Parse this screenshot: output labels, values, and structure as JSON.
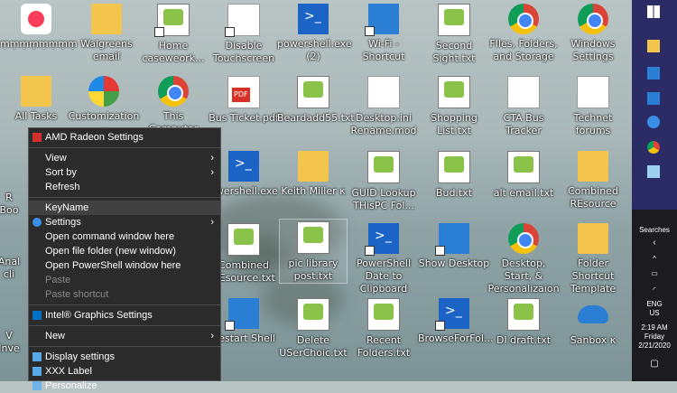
{
  "desktop_icons": [
    {
      "label": "ṃṃṃṃṃṃṃṃ",
      "kind": "itunes-icon"
    },
    {
      "label": "Walgreens email",
      "kind": "folder-icon"
    },
    {
      "label": "Home caseweork...",
      "kind": "text-file-icon"
    },
    {
      "label": "Disable Touchscreen",
      "kind": "document-icon"
    },
    {
      "label": "powershell.exe (2)",
      "kind": "powershell-icon"
    },
    {
      "label": "Wi-Fi - Shortcut",
      "kind": "wifi-icon"
    },
    {
      "label": "Second Sight.txt",
      "kind": "text-file-icon"
    },
    {
      "label": "FIles, Folders, and Storage",
      "kind": "chrome-icon"
    },
    {
      "label": "Windows Settings",
      "kind": "chrome-icon"
    },
    {
      "label": "All Tasks",
      "kind": "folder-icon"
    },
    {
      "label": "Customization -",
      "kind": "shell-icon"
    },
    {
      "label": "This Computer",
      "kind": "chrome-icon"
    },
    {
      "label": "Bus Ticket.pdf",
      "kind": "pdf-icon"
    },
    {
      "label": "Beardadd55.txt",
      "kind": "text-file-icon"
    },
    {
      "label": "Desktop.ini Rename.mod",
      "kind": "document-icon"
    },
    {
      "label": "Shopping List.txt",
      "kind": "text-file-icon"
    },
    {
      "label": "CTA Bus Tracker",
      "kind": "document-icon"
    },
    {
      "label": "Technet forums",
      "kind": "document-icon"
    },
    {
      "label": "owershell.exe",
      "kind": "powershell-icon"
    },
    {
      "label": "Keith Miller κ",
      "kind": "user-folder-icon"
    },
    {
      "label": "GUID Lookup THisPC Fol...",
      "kind": "text-file-icon"
    },
    {
      "label": "Bud.txt",
      "kind": "text-file-icon"
    },
    {
      "label": "alt email.txt",
      "kind": "text-file-icon"
    },
    {
      "label": "Combined REsource",
      "kind": "folder-icon"
    },
    {
      "label": "Combined REsource.txt",
      "kind": "text-file-icon"
    },
    {
      "label": "pic library post.txt",
      "kind": "text-file-icon"
    },
    {
      "label": "PowerShell Date to Clipboard",
      "kind": "powershell-icon"
    },
    {
      "label": "Show Desktop",
      "kind": "blue-icon"
    },
    {
      "label": "Desktop, Start, & Personalizaion",
      "kind": "chrome-icon"
    },
    {
      "label": "Folder Shortcut Template",
      "kind": "folder-icon"
    },
    {
      "label": "Restart Shell",
      "kind": "blue-icon"
    },
    {
      "label": "Delete USerChoic.txt",
      "kind": "text-file-icon"
    },
    {
      "label": "Recent Folders.txt",
      "kind": "text-file-icon"
    },
    {
      "label": "BrowseForFol...",
      "kind": "powershell-icon"
    },
    {
      "label": "DI draft.txt",
      "kind": "text-file-icon"
    },
    {
      "label": "Sanbox κ",
      "kind": "onedrive-icon"
    }
  ],
  "partial_labels": [
    {
      "label": "R"
    },
    {
      "label": "Boo"
    },
    {
      "label": "Anal"
    },
    {
      "label": "cli"
    },
    {
      "label": "V"
    },
    {
      "label": "Inve"
    }
  ],
  "context_menu": {
    "items": [
      {
        "label": "AMD Radeon Settings",
        "icon": "amd-icon",
        "arrow": false,
        "disabled": false,
        "sep_after": true
      },
      {
        "label": "View",
        "arrow": true,
        "disabled": false
      },
      {
        "label": "Sort by",
        "arrow": true,
        "disabled": false
      },
      {
        "label": "Refresh",
        "arrow": false,
        "disabled": false,
        "sep_after": true
      },
      {
        "label": "KeyName",
        "arrow": false,
        "disabled": false,
        "highlight": true
      },
      {
        "label": "Settings",
        "icon": "gear-icon",
        "arrow": true,
        "disabled": false
      },
      {
        "label": "Open command window here",
        "arrow": false,
        "disabled": false
      },
      {
        "label": "Open file folder (new window)",
        "arrow": false,
        "disabled": false
      },
      {
        "label": "Open PowerShell window here",
        "arrow": false,
        "disabled": false
      },
      {
        "label": "Paste",
        "arrow": false,
        "disabled": true
      },
      {
        "label": "Paste shortcut",
        "arrow": false,
        "disabled": true,
        "sep_after": true
      },
      {
        "label": "Intel® Graphics Settings",
        "icon": "intel-icon",
        "arrow": false,
        "disabled": false,
        "sep_after": true
      },
      {
        "label": "New",
        "arrow": true,
        "disabled": false,
        "sep_after": true
      },
      {
        "label": "Display settings",
        "icon": "display-icon",
        "arrow": false,
        "disabled": false
      },
      {
        "label": "XXX Label",
        "icon": "display-icon",
        "arrow": false,
        "disabled": false
      },
      {
        "label": "Personalize",
        "icon": "personalize-icon",
        "arrow": false,
        "disabled": false
      }
    ]
  },
  "taskbar": {
    "search_label": "Searches",
    "lang": "ENG",
    "region": "US",
    "time": "2:19 AM",
    "day": "Friday",
    "date": "2/21/2020"
  },
  "colors": {
    "menu_bg": "#2b2b2b",
    "taskbar_top": "#2b2b66",
    "highlight": "#414141"
  }
}
